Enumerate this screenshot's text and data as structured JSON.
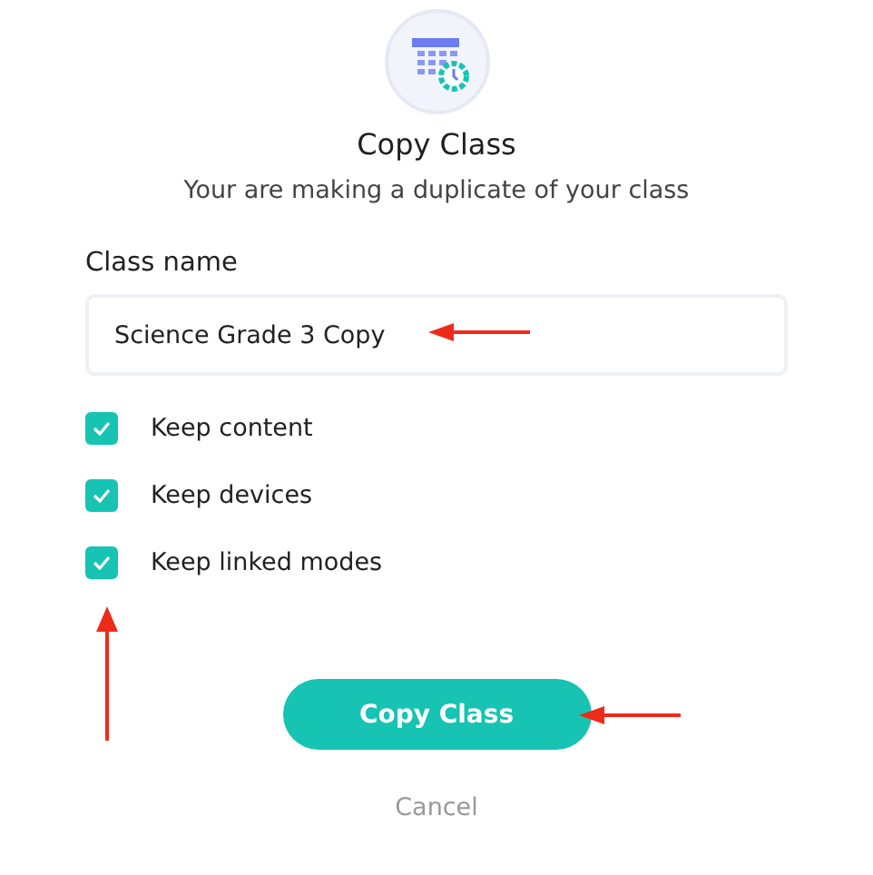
{
  "dialog": {
    "title": "Copy Class",
    "subtitle": "Your are making a duplicate of your class"
  },
  "class_name": {
    "label": "Class name",
    "value": "Science Grade 3 Copy"
  },
  "options": [
    {
      "label": "Keep content",
      "checked": true
    },
    {
      "label": "Keep devices",
      "checked": true
    },
    {
      "label": "Keep linked modes",
      "checked": true
    }
  ],
  "buttons": {
    "primary": "Copy Class",
    "cancel": "Cancel"
  }
}
